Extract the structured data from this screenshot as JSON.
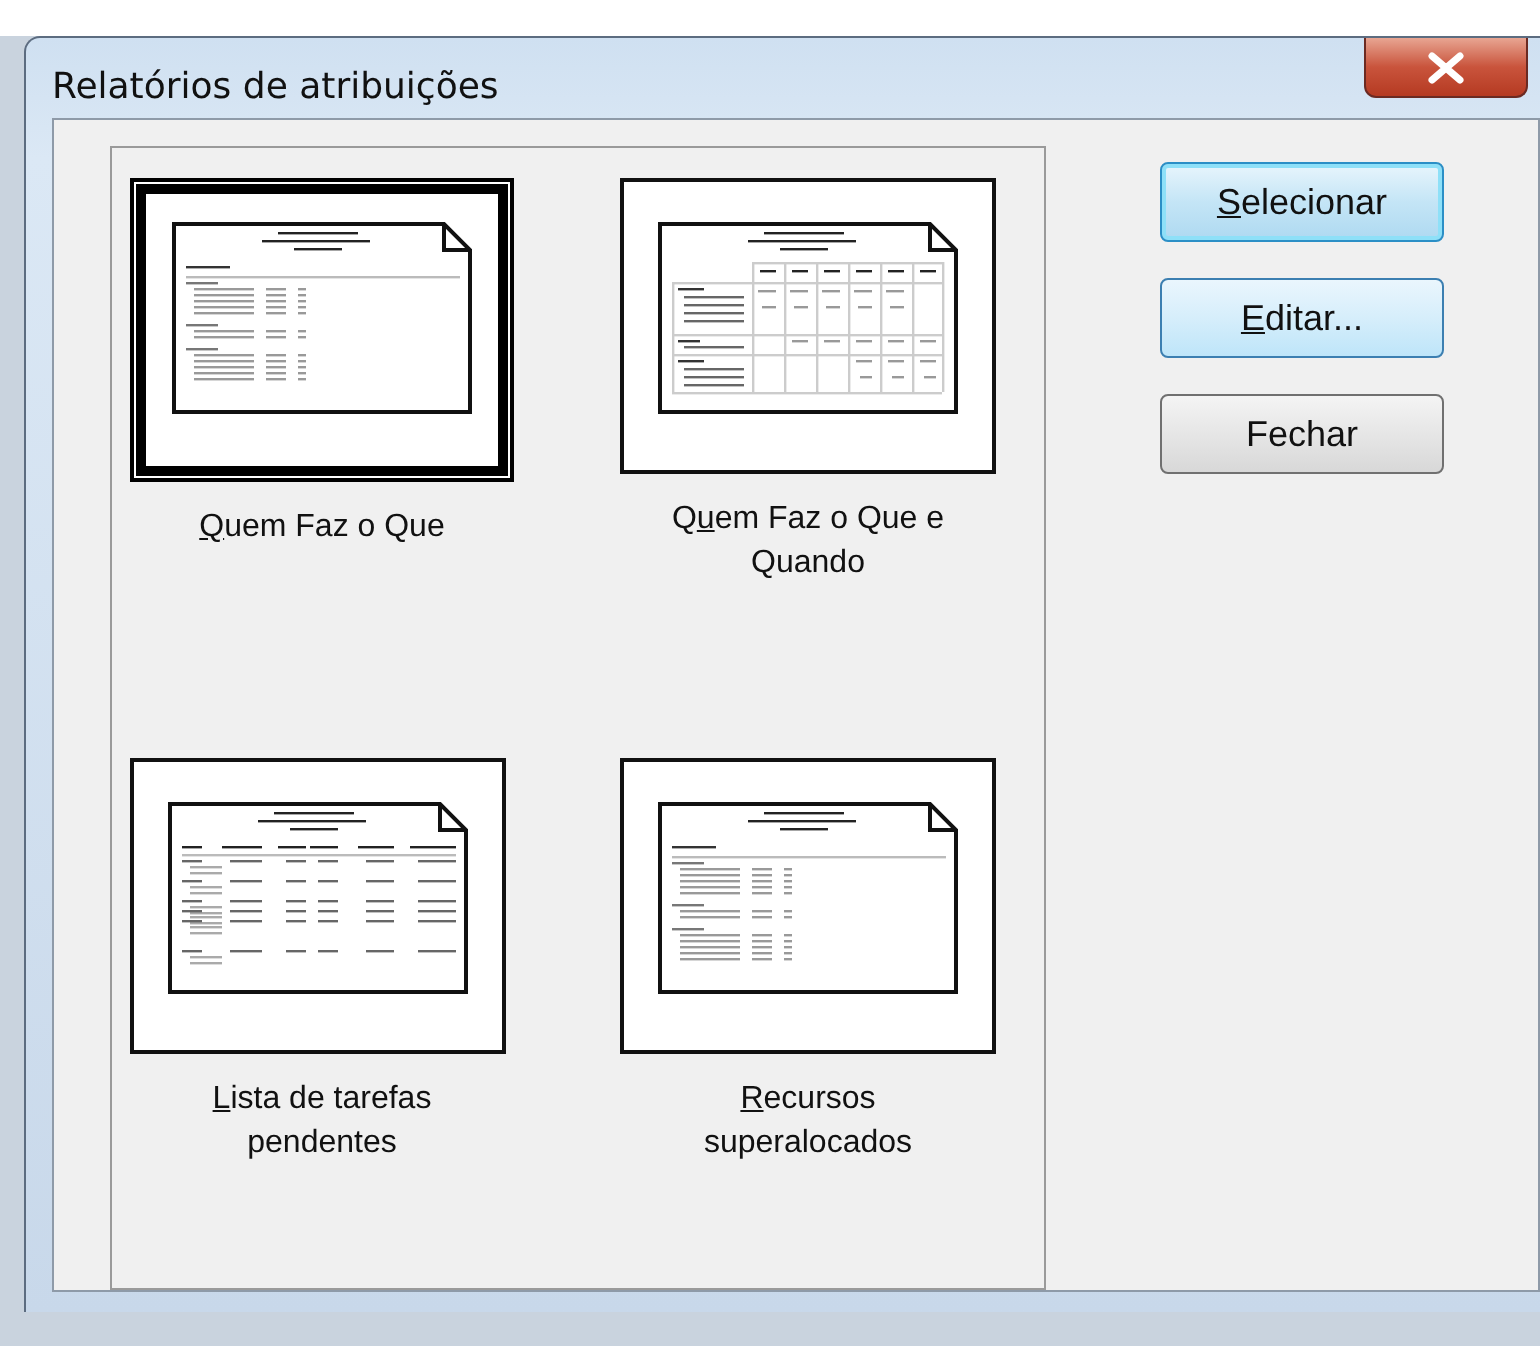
{
  "window": {
    "title": "Relatórios de atribuições"
  },
  "reports": [
    {
      "kind": "list",
      "selected": true,
      "label": {
        "key": "Q",
        "after": "uem Faz o Que"
      }
    },
    {
      "kind": "grid",
      "selected": false,
      "label": {
        "before": "Q",
        "key": "u",
        "after": "em Faz o Que e Quando"
      }
    },
    {
      "kind": "table",
      "selected": false,
      "label": {
        "key": "L",
        "after": "ista de tarefas pendentes"
      }
    },
    {
      "kind": "list",
      "selected": false,
      "label": {
        "key": "R",
        "after": "ecursos superalocados"
      }
    }
  ],
  "buttons": [
    {
      "kind": "default",
      "label": {
        "key": "S",
        "after": "elecionar"
      }
    },
    {
      "kind": "hot",
      "label": {
        "key": "E",
        "after": "ditar..."
      }
    },
    {
      "kind": "normal",
      "label": {
        "after": "Fechar"
      }
    }
  ]
}
